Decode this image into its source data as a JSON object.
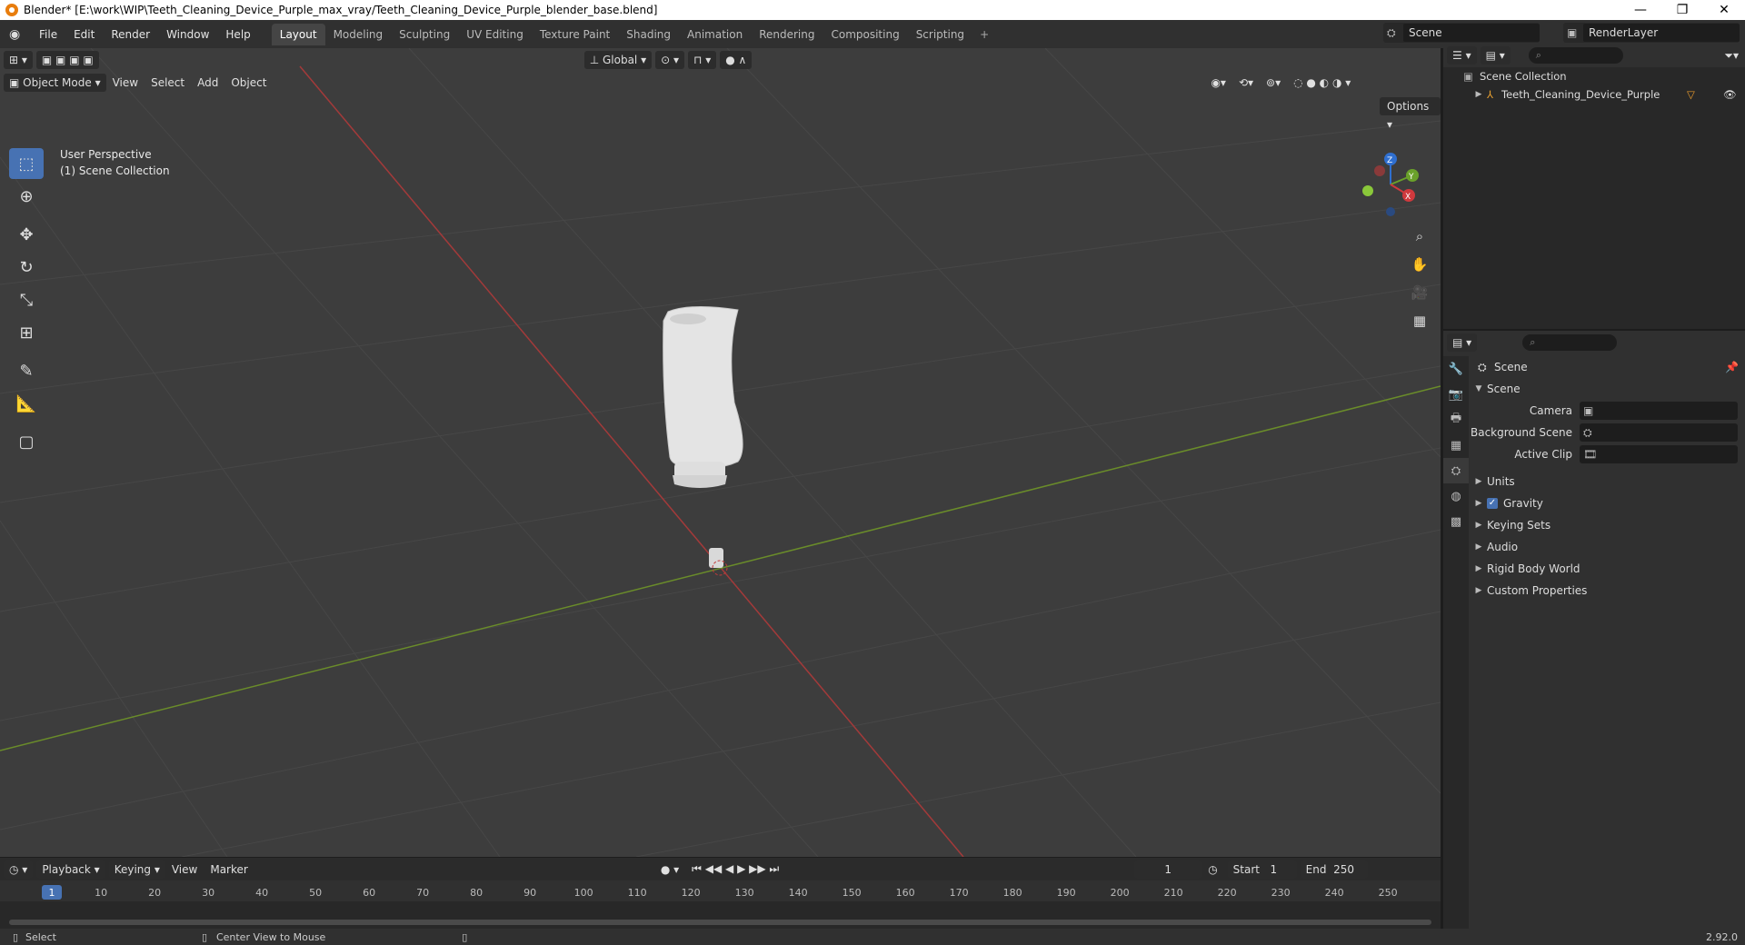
{
  "window": {
    "title": "Blender* [E:\\work\\WIP\\Teeth_Cleaning_Device_Purple_max_vray/Teeth_Cleaning_Device_Purple_blender_base.blend]",
    "minimize": "—",
    "maximize": "❐",
    "close": "✕"
  },
  "menu": {
    "items": [
      "File",
      "Edit",
      "Render",
      "Window",
      "Help"
    ],
    "workspaces": [
      "Layout",
      "Modeling",
      "Sculpting",
      "UV Editing",
      "Texture Paint",
      "Shading",
      "Animation",
      "Rendering",
      "Compositing",
      "Scripting"
    ],
    "active_workspace": "Layout",
    "add_tab": "+",
    "scene": "Scene",
    "render_layer": "RenderLayer"
  },
  "viewport": {
    "orientation": "Global",
    "options": "Options",
    "mode": "Object Mode",
    "menus": [
      "View",
      "Select",
      "Add",
      "Object"
    ],
    "perspective": "User Perspective",
    "collection": "(1) Scene Collection",
    "gizmo_axes": [
      "X",
      "Y",
      "Z"
    ],
    "tools": [
      "select-box",
      "cursor",
      "move",
      "rotate",
      "scale",
      "transform",
      "annotate",
      "measure",
      "add-cube"
    ]
  },
  "timeline": {
    "menus": [
      "Playback",
      "Keying",
      "View",
      "Marker"
    ],
    "current_frame": "1",
    "start_label": "Start",
    "start": "1",
    "end_label": "End",
    "end": "250",
    "ticks": [
      "1",
      "10",
      "20",
      "30",
      "40",
      "50",
      "60",
      "70",
      "80",
      "90",
      "100",
      "110",
      "120",
      "130",
      "140",
      "150",
      "160",
      "170",
      "180",
      "190",
      "200",
      "210",
      "220",
      "230",
      "240",
      "250"
    ]
  },
  "status": {
    "select": "Select",
    "center": "Center View to Mouse",
    "version": "2.92.0"
  },
  "outliner": {
    "root": "Scene Collection",
    "object": "Teeth_Cleaning_Device_Purple"
  },
  "properties": {
    "context": "Scene",
    "panel_open": "Scene",
    "fields": [
      {
        "label": "Camera"
      },
      {
        "label": "Background Scene"
      },
      {
        "label": "Active Clip"
      }
    ],
    "panels": [
      "Units",
      "Gravity",
      "Keying Sets",
      "Audio",
      "Rigid Body World",
      "Custom Properties"
    ]
  }
}
